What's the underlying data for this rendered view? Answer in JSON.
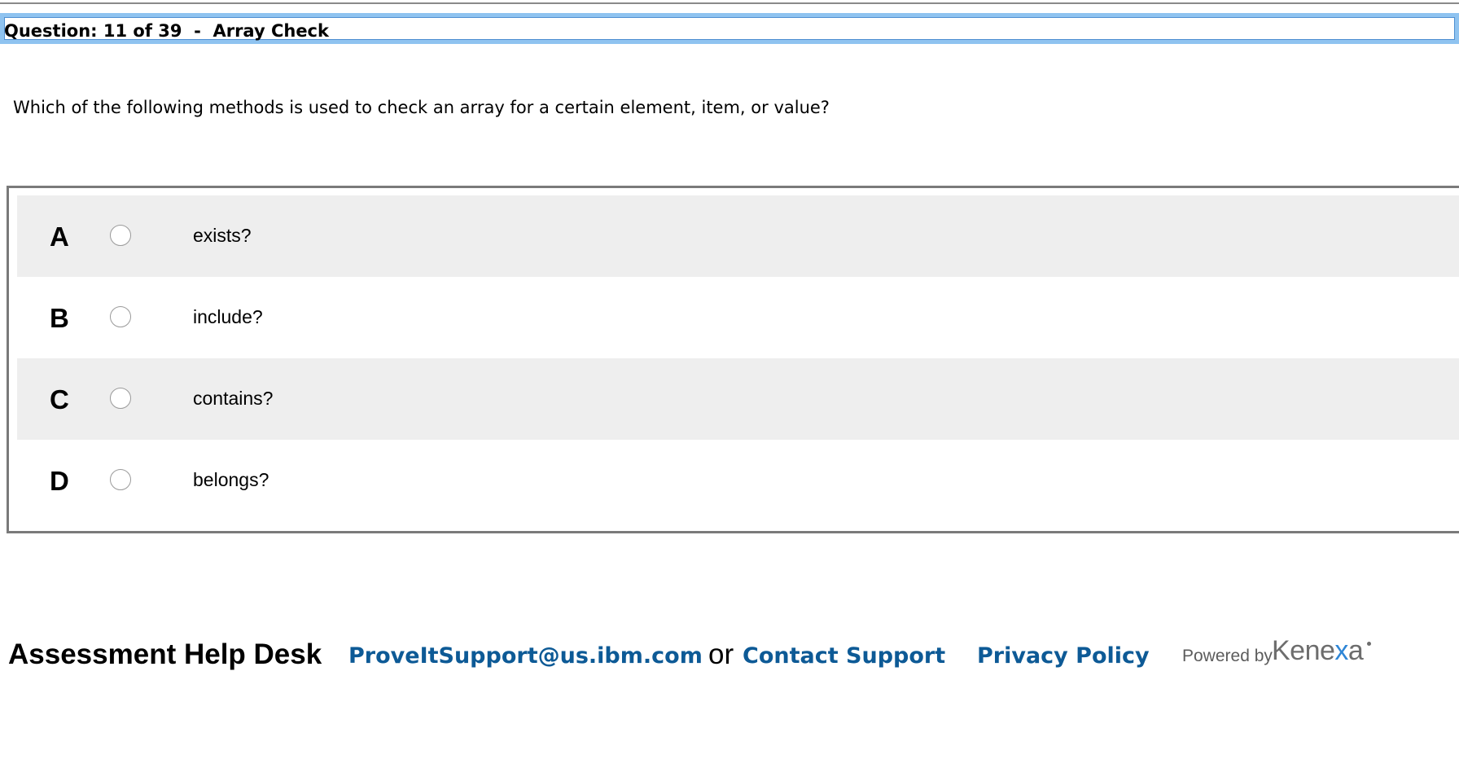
{
  "header": {
    "question_title": "Question: 11 of 39  -  Array Check"
  },
  "question": {
    "text": "Which of the following methods is used to check an array for a certain element, item, or value?"
  },
  "answers": [
    {
      "letter": "A",
      "text": "exists?",
      "selected": false
    },
    {
      "letter": "B",
      "text": "include?",
      "selected": false
    },
    {
      "letter": "C",
      "text": "contains?",
      "selected": false
    },
    {
      "letter": "D",
      "text": "belongs?",
      "selected": false
    }
  ],
  "footer": {
    "help_desk_label": "Assessment Help Desk",
    "support_email": "ProveItSupport@us.ibm.com",
    "or_text": "or",
    "contact_support": "Contact Support",
    "privacy_policy": "Privacy Policy",
    "powered_by": "Powered by",
    "brand": "Kenexa",
    "brand_color": "#2e86d6",
    "link_color": "#0d5a96"
  }
}
